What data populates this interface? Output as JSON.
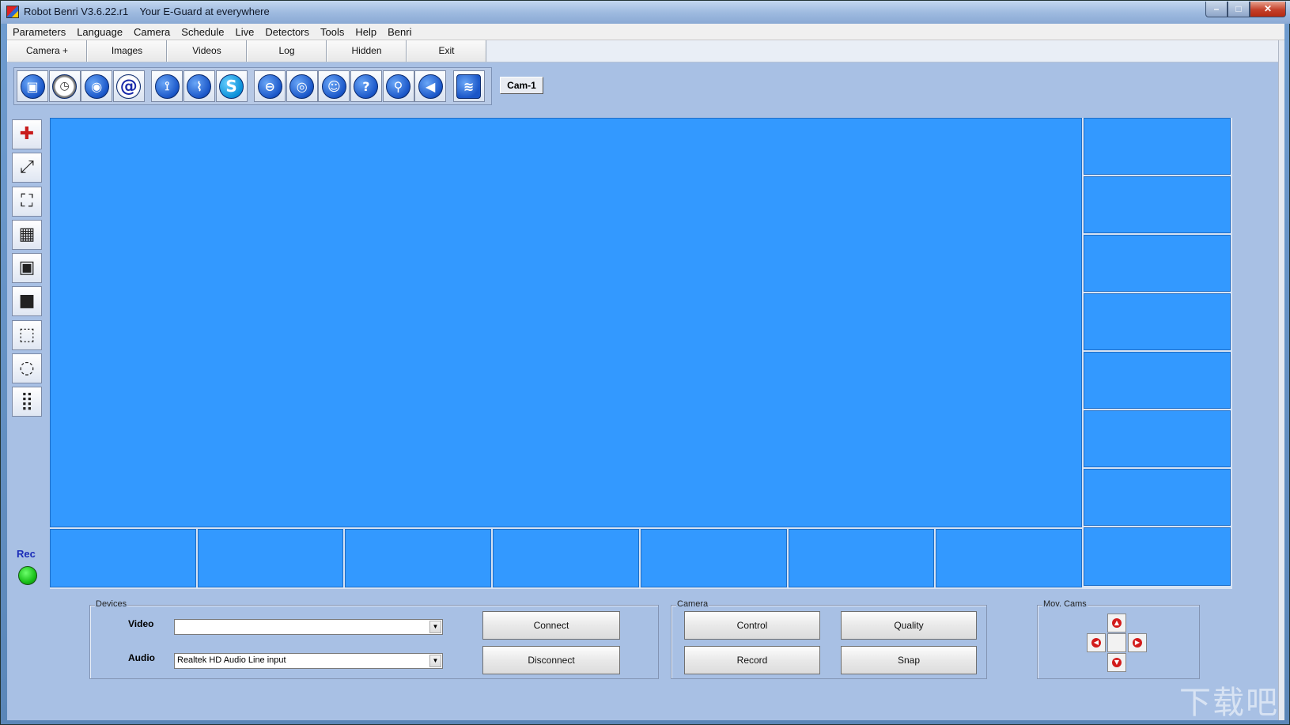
{
  "window": {
    "title": "Robot Benri V3.6.22.r1    Your E-Guard at everywhere",
    "min_glyph": "–",
    "max_glyph": "□",
    "close_glyph": "✕"
  },
  "menu": [
    "Parameters",
    "Language",
    "Camera",
    "Schedule",
    "Live",
    "Detectors",
    "Tools",
    "Help",
    "Benri"
  ],
  "tabs": [
    "Camera +",
    "Images",
    "Videos",
    "Log",
    "Hidden",
    "Exit"
  ],
  "toolbar": {
    "groups": [
      [
        {
          "icon": "camcorder-icon",
          "glyph": "▣",
          "style": ""
        },
        {
          "icon": "clock-icon",
          "glyph": "◷",
          "style": "clock"
        },
        {
          "icon": "camera-icon",
          "glyph": "◉",
          "style": ""
        },
        {
          "icon": "email-icon",
          "glyph": "@",
          "style": "at"
        }
      ],
      [
        {
          "icon": "satellite-dish-icon",
          "glyph": "⟟",
          "style": ""
        },
        {
          "icon": "broadcast-tower-icon",
          "glyph": "⌇",
          "style": ""
        },
        {
          "icon": "skype-icon",
          "glyph": "S",
          "style": "skype"
        }
      ],
      [
        {
          "icon": "motion-detector-icon",
          "glyph": "⊖",
          "style": ""
        },
        {
          "icon": "eye-icon",
          "glyph": "◎",
          "style": ""
        },
        {
          "icon": "face-detector-icon",
          "glyph": "☺",
          "style": ""
        },
        {
          "icon": "help-head-icon",
          "glyph": "?",
          "style": ""
        },
        {
          "icon": "person-icon",
          "glyph": "⚲",
          "style": ""
        },
        {
          "icon": "speaker-icon",
          "glyph": "◀",
          "style": ""
        }
      ],
      [
        {
          "icon": "rss-feed-icon",
          "glyph": "≋",
          "style": "rss"
        }
      ]
    ],
    "camera_label": "Cam-1"
  },
  "left_tools": [
    {
      "name": "add-camera-icon",
      "glyph": "✚"
    },
    {
      "name": "fullscreen-expand-icon",
      "glyph": "⤢"
    },
    {
      "name": "fit-frame-icon",
      "glyph": "⛶"
    },
    {
      "name": "grid-layout-icon",
      "glyph": "▦"
    },
    {
      "name": "single-layout-icon",
      "glyph": "▣"
    },
    {
      "name": "video-camera-icon",
      "glyph": "■"
    },
    {
      "name": "select-region-icon",
      "glyph": "⬚"
    },
    {
      "name": "circle-region-icon",
      "glyph": "◌"
    },
    {
      "name": "keypad-icon",
      "glyph": "⣿"
    }
  ],
  "rec": {
    "label": "Rec",
    "status_color": "#19c019"
  },
  "view": {
    "main_color": "#3399ff",
    "side_cells": 7,
    "bottom_cells": 7,
    "corner_cells": 1
  },
  "devices": {
    "title": "Devices",
    "video_label": "Video",
    "video_value": "",
    "audio_label": "Audio",
    "audio_value": "Realtek HD Audio Line input",
    "connect_label": "Connect",
    "disconnect_label": "Disconnect"
  },
  "camera_group": {
    "title": "Camera",
    "control_label": "Control",
    "quality_label": "Quality",
    "record_label": "Record",
    "snap_label": "Snap"
  },
  "mov_cams": {
    "title": "Mov. Cams"
  },
  "watermark": "下载吧"
}
